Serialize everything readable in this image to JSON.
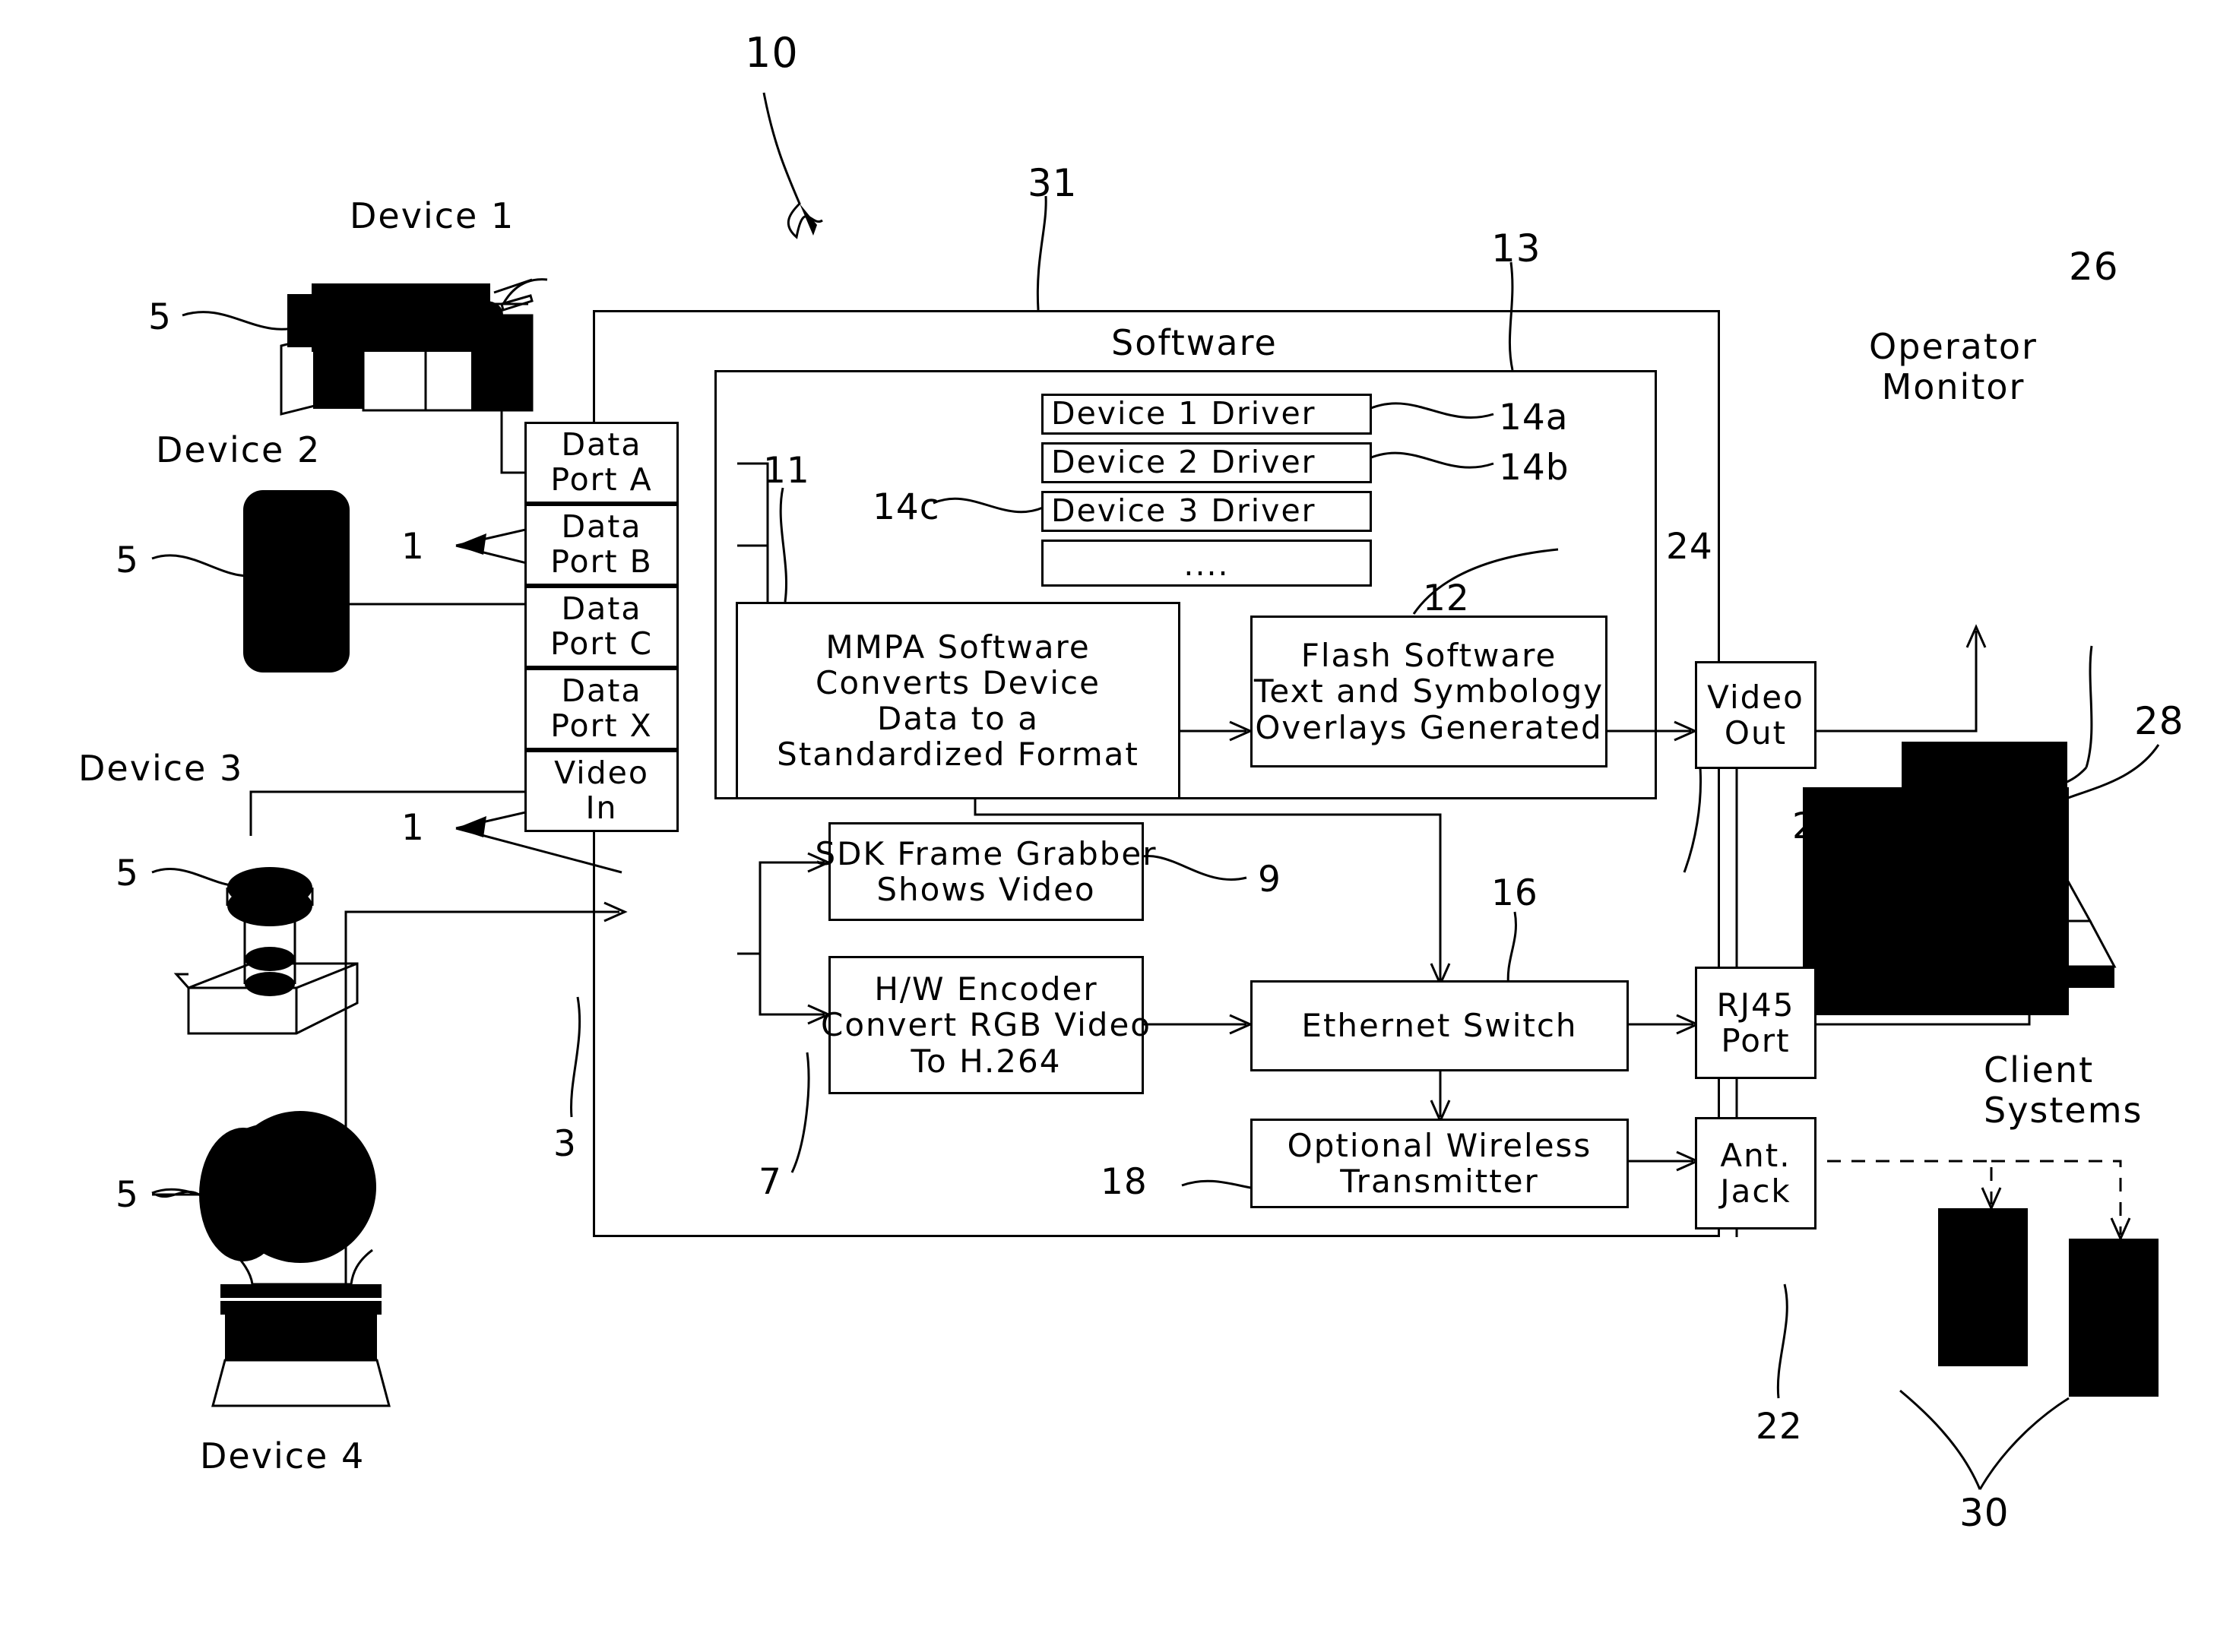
{
  "diagram": {
    "title_ref": "10",
    "software_label": "Software",
    "software_ref_left": "31",
    "software_ref_right": "13"
  },
  "devices": [
    {
      "name": "Device 1",
      "ref": "5",
      "icon": "video-camera-icon"
    },
    {
      "name": "Device 2",
      "ref": "5",
      "icon": "handheld-terminal-icon"
    },
    {
      "name": "Device 3",
      "ref": "5",
      "icon": "joystick-icon"
    },
    {
      "name": "Device 4",
      "ref": "5",
      "icon": "pan-tilt-camera-icon"
    }
  ],
  "ports": {
    "ref_top": "1",
    "ref_bottom": "1",
    "ref_video_in": "3",
    "items": [
      {
        "l1": "Data",
        "l2": "Port A"
      },
      {
        "l1": "Data",
        "l2": "Port B"
      },
      {
        "l1": "Data",
        "l2": "Port C"
      },
      {
        "l1": "Data",
        "l2": "Port X"
      },
      {
        "l1": "Video",
        "l2": "In"
      }
    ]
  },
  "drivers": {
    "ref_a": "14a",
    "ref_b": "14b",
    "ref_c": "14c",
    "items": [
      {
        "label": "Device 1 Driver"
      },
      {
        "label": "Device 2 Driver"
      },
      {
        "label": "Device 3 Driver"
      },
      {
        "label": "...."
      }
    ]
  },
  "blocks": {
    "mmpa": {
      "ref": "11",
      "lines": [
        "MMPA Software",
        "Converts Device",
        "Data to a",
        "Standardized Format"
      ]
    },
    "flash": {
      "ref": "12",
      "lines": [
        "Flash Software",
        "Text and Symbology",
        "Overlays Generated"
      ]
    },
    "sdk": {
      "ref": "9",
      "lines": [
        "SDK Frame Grabber",
        "Shows Video"
      ]
    },
    "encoder": {
      "ref": "7",
      "lines": [
        "H/W Encoder",
        "Convert RGB Video",
        "To H.264"
      ]
    },
    "ethernet": {
      "ref": "16",
      "lines": [
        "Ethernet Switch"
      ]
    },
    "wireless": {
      "ref": "18",
      "lines": [
        "Optional Wireless",
        "Transmitter"
      ]
    },
    "video_out": {
      "ref": "24",
      "lines": [
        "Video",
        "Out"
      ]
    },
    "rj45": {
      "ref": "20",
      "lines": [
        "RJ45",
        "Port"
      ]
    },
    "ant_jack": {
      "ref": "22",
      "lines": [
        "Ant.",
        "Jack"
      ]
    }
  },
  "outputs": {
    "operator_monitor": {
      "l1": "Operator",
      "l2": "Monitor",
      "ref": "26"
    },
    "laptop": {
      "ref": "28"
    },
    "client_systems": {
      "l1": "Client",
      "l2": "Systems"
    },
    "phones": {
      "ref": "30"
    }
  },
  "colors": {
    "ink": "#000000",
    "paper": "#ffffff"
  }
}
